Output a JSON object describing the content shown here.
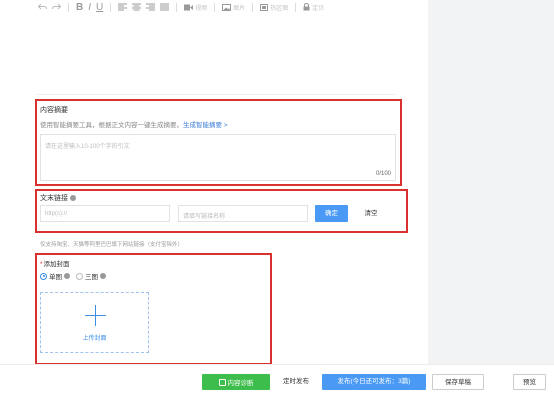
{
  "toolbar": {
    "video_label": "视频",
    "image_label": "图片",
    "hotspot_label": "热区图",
    "lock_label": "定贝"
  },
  "summary": {
    "title": "内容摘要",
    "desc": "使用智能摘要工具，根据正文内容一键生成摘要。",
    "link": "生成智能摘要 >",
    "placeholder": "请在这里输入10-100个字的引文",
    "counter": "0/100"
  },
  "link_section": {
    "title": "文末链接",
    "url_placeholder": "http(s)://",
    "name_placeholder": "请填写链接名称",
    "confirm_label": "确定",
    "clear_label": "清空",
    "hint": "仅支持淘宝、天猫等阿里巴巴旗下网站链接（支付宝除外）"
  },
  "cover": {
    "required_mark": "*",
    "title": "添加封面",
    "option_single": "单图",
    "option_triple": "三图",
    "upload_label": "上传封面"
  },
  "footer": {
    "diagnose_label": "内容诊断",
    "timed_label": "定时发布",
    "publish_label": "发布(今日还可发布：3篇)",
    "draft_label": "保存草稿",
    "preview_label": "预览"
  },
  "colors": {
    "accent": "#4a9af5",
    "highlight_box": "#d93030",
    "diagnose_green": "#3dbd4c"
  }
}
